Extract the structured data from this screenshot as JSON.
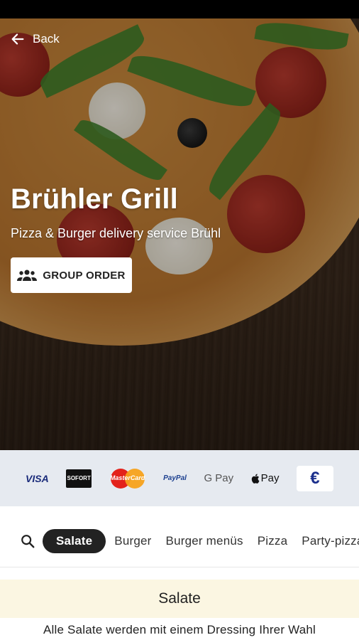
{
  "header": {
    "back_label": "Back",
    "title": "Brühler Grill",
    "subtitle": "Pizza & Burger delivery service Brühl",
    "group_order_label": "GROUP ORDER"
  },
  "payments": {
    "methods": [
      "VISA",
      "SOFORT",
      "MasterCard",
      "PayPal",
      "G Pay",
      "Pay",
      "€"
    ]
  },
  "categories": {
    "items": [
      "Salate",
      "Burger",
      "Burger menüs",
      "Pizza",
      "Party-pizza"
    ],
    "active": "Salate"
  },
  "section": {
    "title": "Salate",
    "description": "Alle Salate werden mit einem Dressing Ihrer Wahl"
  },
  "colors": {
    "accent_dark": "#222222",
    "payment_bar": "#e6eaf0",
    "section_bg": "#fbf6e2"
  }
}
